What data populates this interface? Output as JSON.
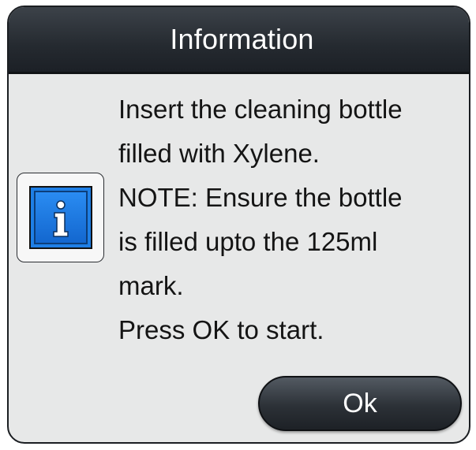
{
  "dialog": {
    "title": "Information",
    "icon": "info-icon",
    "message_lines": [
      "Insert the cleaning bottle",
      "filled with Xylene.",
      "NOTE: Ensure the bottle",
      "is filled upto the 125ml",
      "mark.",
      "Press OK to start."
    ],
    "ok_label": "Ok"
  },
  "colors": {
    "titlebar": "#252a30",
    "body": "#e7e8e8",
    "icon_blue": "#1e7fe6",
    "button": "#2c3137"
  }
}
